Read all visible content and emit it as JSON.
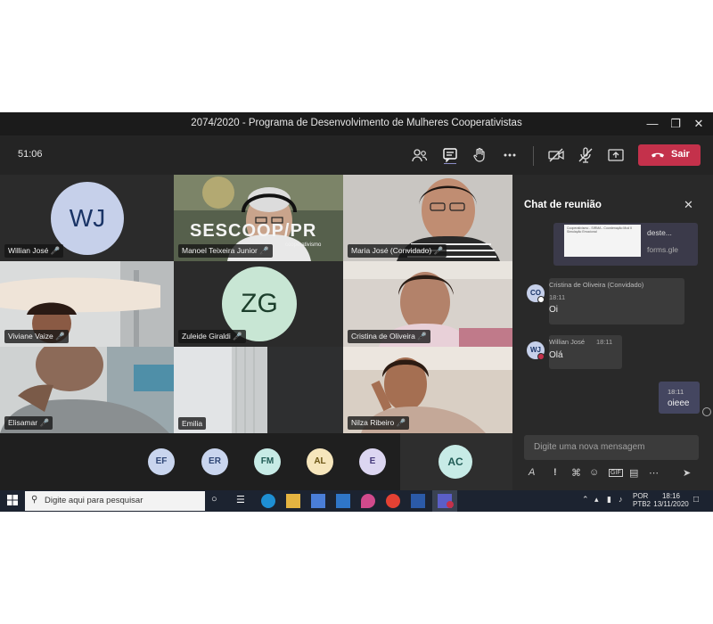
{
  "window": {
    "title": "2074/2020 - Programa de Desenvolvimento de Mulheres Cooperativistas",
    "controls": [
      "minimize",
      "maximize",
      "close"
    ]
  },
  "meeting": {
    "timer": "51:06",
    "toolbar_icons": [
      "people-icon",
      "chat-icon",
      "raise-hand-icon",
      "more-icon",
      "camera-off-icon",
      "mic-off-icon",
      "share-screen-icon"
    ],
    "leave_label": "Sair",
    "leave_color": "#c4314b"
  },
  "participants": [
    {
      "name": "Willian José",
      "initials": "WJ",
      "avatar_bg": "#c6d0ea",
      "avatar_fg": "#1a3466"
    },
    {
      "name": "Manoel Teixeira Junior",
      "background_text": "SESCOOP/PR",
      "background_subtext": "cooperativismo"
    },
    {
      "name": "Maria José (Convidado)"
    },
    {
      "name": "Viviane Vaize"
    },
    {
      "name": "Zuleide Giraldi",
      "initials": "ZG",
      "avatar_bg": "#c8e6d4",
      "avatar_fg": "#1c3e2b"
    },
    {
      "name": "Cristina de Oliveira"
    },
    {
      "name": "Elisamar"
    },
    {
      "name": "Emilia"
    },
    {
      "name": "Nilza Ribeiro"
    }
  ],
  "strip": [
    {
      "initials": "EF",
      "bg": "#c9d5ee",
      "fg": "#2f4675"
    },
    {
      "initials": "ER",
      "bg": "#c9d5ee",
      "fg": "#2f4675"
    },
    {
      "initials": "FM",
      "bg": "#c7ebe6",
      "fg": "#1f5b55"
    },
    {
      "initials": "AL",
      "bg": "#f6e6bc",
      "fg": "#6b5514"
    },
    {
      "initials": "E",
      "bg": "#dcd6f1",
      "fg": "#45397a"
    },
    {
      "initials": "AC",
      "bg": "#c7ebe6",
      "fg": "#1f5b55"
    }
  ],
  "chat": {
    "title": "Chat de reunião",
    "card_text": "deste...",
    "card_domain": "forms.gle",
    "card_preview_lines": [
      "Cooperativismo - SIRMA - Coordenação Mod II Simulação Emocional"
    ],
    "messages": [
      {
        "initials": "CO",
        "sender": "Cristina de Oliveira (Convidado)",
        "time": "18:11",
        "text": "Oi",
        "avatar_bg": "#c6d0ea",
        "status_color": "#ffffff"
      },
      {
        "initials": "WJ",
        "sender": "Willian José",
        "time": "18:11",
        "text": "Olá",
        "avatar_bg": "#c6d0ea",
        "status_color": "#c4314b"
      },
      {
        "own": true,
        "time": "18:11",
        "text": "oieee"
      }
    ],
    "compose_placeholder": "Digite uma nova mensagem",
    "compose_icons": [
      "format-icon",
      "important-icon",
      "attach-icon",
      "emoji-icon",
      "gif-icon",
      "sticker-icon",
      "more-icon",
      "send-icon"
    ]
  },
  "taskbar": {
    "search_placeholder": "Digite aqui para pesquisar",
    "lang": "POR",
    "layout": "PTB2",
    "time": "18:16",
    "date": "13/11/2020"
  }
}
